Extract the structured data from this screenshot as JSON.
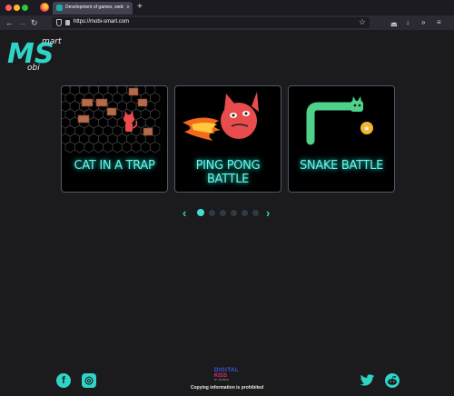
{
  "browser": {
    "tab_title": "Development of games, website",
    "tab_close": "×",
    "new_tab": "+",
    "url": "https://mobi-smart.com",
    "nav": {
      "back": "←",
      "forward": "→",
      "reload": "↻"
    },
    "icons": {
      "star": "☆",
      "pocket": "◛",
      "download": "↓",
      "extensions": "»",
      "menu": "≡"
    }
  },
  "logo": {
    "big": "MS",
    "small_top": "mart",
    "small_bottom": "obi"
  },
  "cards": [
    {
      "title": "CAT IN A TRAP",
      "icon": "cat-in-trap-illustration"
    },
    {
      "title_line1": "PING PONG",
      "title_line2": "BATTLE",
      "icon": "flaming-cat-ball-illustration"
    },
    {
      "title": "SNAKE BATTLE",
      "icon": "snake-illustration"
    }
  ],
  "carousel": {
    "prev": "‹",
    "next": "›",
    "dots": 6,
    "active": 0
  },
  "footer": {
    "copyright": "Copying information is prohibited",
    "partner_line1": "DIGITAL",
    "partner_line2": "KISS",
    "partner_line3": "BY MOBILE",
    "social": {
      "facebook": "f",
      "instagram": "◎",
      "twitter": "🐦",
      "reddit": "●"
    }
  },
  "colors": {
    "accent": "#2fd4c7",
    "neon_text": "#6ff2e8",
    "page_bg": "#1b1b1d"
  }
}
